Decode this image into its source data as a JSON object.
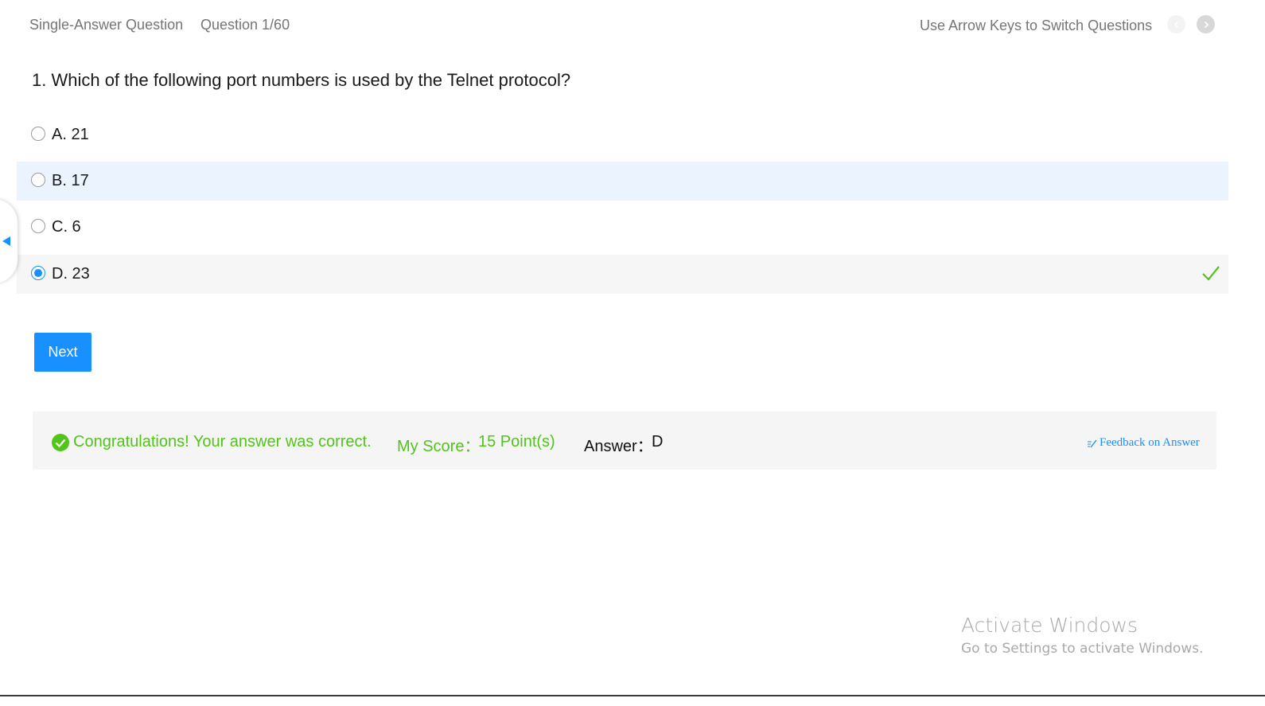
{
  "header": {
    "question_type": "Single-Answer Question",
    "question_counter": "Question 1/60",
    "keyboard_hint": "Use Arrow Keys to Switch Questions",
    "prev_icon": "chevron-left-icon",
    "next_icon": "chevron-right-icon"
  },
  "question": {
    "text": "1. Which of the following port numbers is used by the Telnet protocol?"
  },
  "options": [
    {
      "label": "A. 21",
      "selected": false
    },
    {
      "label": "B. 17",
      "selected": false
    },
    {
      "label": "C. 6",
      "selected": false
    },
    {
      "label": "D. 23",
      "selected": true,
      "correct": true
    }
  ],
  "actions": {
    "next_label": "Next"
  },
  "result": {
    "message": "Congratulations! Your answer was correct.",
    "score_label": "My Score：",
    "score_value": "15 Point(s)",
    "answer_label": "Answer：",
    "answer_value": "D",
    "feedback_label": "Feedback on Answer"
  },
  "watermark": {
    "title": "Activate Windows",
    "subtitle": "Go to Settings to activate Windows."
  },
  "colors": {
    "accent": "#1890ff",
    "success": "#52c41a",
    "hover_row": "#eaf3fe",
    "selected_row": "#f6f6f6"
  }
}
